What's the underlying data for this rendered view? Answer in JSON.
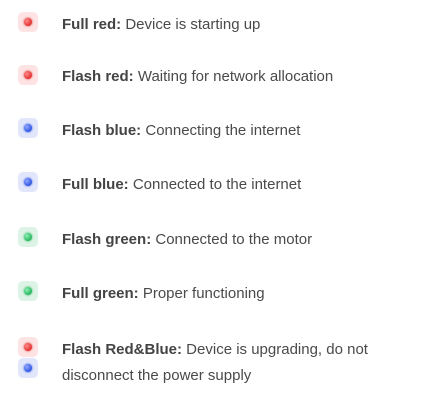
{
  "items": [
    {
      "label": "Full red:",
      "desc": " Device is starting up"
    },
    {
      "label": "Flash red:",
      "desc": " Waiting for network allocation"
    },
    {
      "label": "Flash blue:",
      "desc": " Connecting the internet"
    },
    {
      "label": "Full blue:",
      "desc": " Connected to the internet"
    },
    {
      "label": "Flash green:",
      "desc": " Connected to the motor"
    },
    {
      "label": "Full green:",
      "desc": " Proper functioning"
    },
    {
      "label": "Flash Red&Blue:",
      "desc": " Device is upgrading, do not disconnect the power supply"
    }
  ],
  "colors": {
    "red": "#e0302f",
    "blue": "#3056e0",
    "green": "#24b35c"
  }
}
